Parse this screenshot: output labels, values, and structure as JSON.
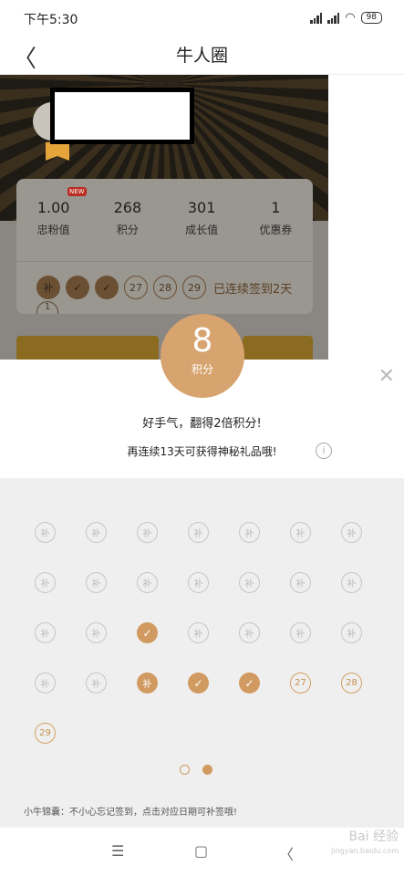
{
  "status_bar": {
    "time": "下午5:30",
    "battery": "98"
  },
  "nav": {
    "title": "牛人圈",
    "back_icon": "chevron-left-icon"
  },
  "profile_card": {
    "new_tag": "NEW",
    "stats": [
      {
        "value": "1.00",
        "label": "忠粉值"
      },
      {
        "value": "268",
        "label": "积分"
      },
      {
        "value": "301",
        "label": "成长值"
      },
      {
        "value": "1",
        "label": "优惠券"
      }
    ],
    "mini_days": [
      "补",
      "✓",
      "✓",
      "27",
      "28",
      "29"
    ],
    "mini_streak_text": "已连续签到2天",
    "mini_extra": "1"
  },
  "reward": {
    "points": "8",
    "unit": "积分",
    "message": "好手气，翻得2倍积分!",
    "hint": "再连续13天可获得神秘礼品哦!",
    "info_icon": "i"
  },
  "calendar": {
    "days": [
      {
        "state": "miss",
        "text": "补"
      },
      {
        "state": "miss",
        "text": "补"
      },
      {
        "state": "miss",
        "text": "补"
      },
      {
        "state": "miss",
        "text": "补"
      },
      {
        "state": "miss",
        "text": "补"
      },
      {
        "state": "miss",
        "text": "补"
      },
      {
        "state": "miss",
        "text": "补"
      },
      {
        "state": "miss",
        "text": "补"
      },
      {
        "state": "miss",
        "text": "补"
      },
      {
        "state": "miss",
        "text": "补"
      },
      {
        "state": "miss",
        "text": "补"
      },
      {
        "state": "miss",
        "text": "补"
      },
      {
        "state": "miss",
        "text": "补"
      },
      {
        "state": "miss",
        "text": "补"
      },
      {
        "state": "miss",
        "text": "补"
      },
      {
        "state": "miss",
        "text": "补"
      },
      {
        "state": "done",
        "text": "✓"
      },
      {
        "state": "miss",
        "text": "补"
      },
      {
        "state": "miss",
        "text": "补"
      },
      {
        "state": "miss",
        "text": "补"
      },
      {
        "state": "miss",
        "text": "补"
      },
      {
        "state": "miss",
        "text": "补"
      },
      {
        "state": "miss",
        "text": "补"
      },
      {
        "state": "made",
        "text": "补"
      },
      {
        "state": "done",
        "text": "✓"
      },
      {
        "state": "done",
        "text": "✓"
      },
      {
        "state": "future",
        "text": "27"
      },
      {
        "state": "future",
        "text": "28"
      },
      {
        "state": "future",
        "text": "29"
      }
    ],
    "page_count": 2,
    "active_page": 2,
    "tip": "小牛锦囊：不小心忘记签到，点击对应日期可补签哦!"
  },
  "system_nav": {
    "menu": "☰",
    "home": "▢",
    "back": "〈"
  },
  "watermark": {
    "text": "Bai 经验",
    "sub": "jingyan.baidu.com"
  },
  "colors": {
    "accent": "#d09a60",
    "sheet": "#ffffff",
    "calendar_bg": "#efefef"
  }
}
